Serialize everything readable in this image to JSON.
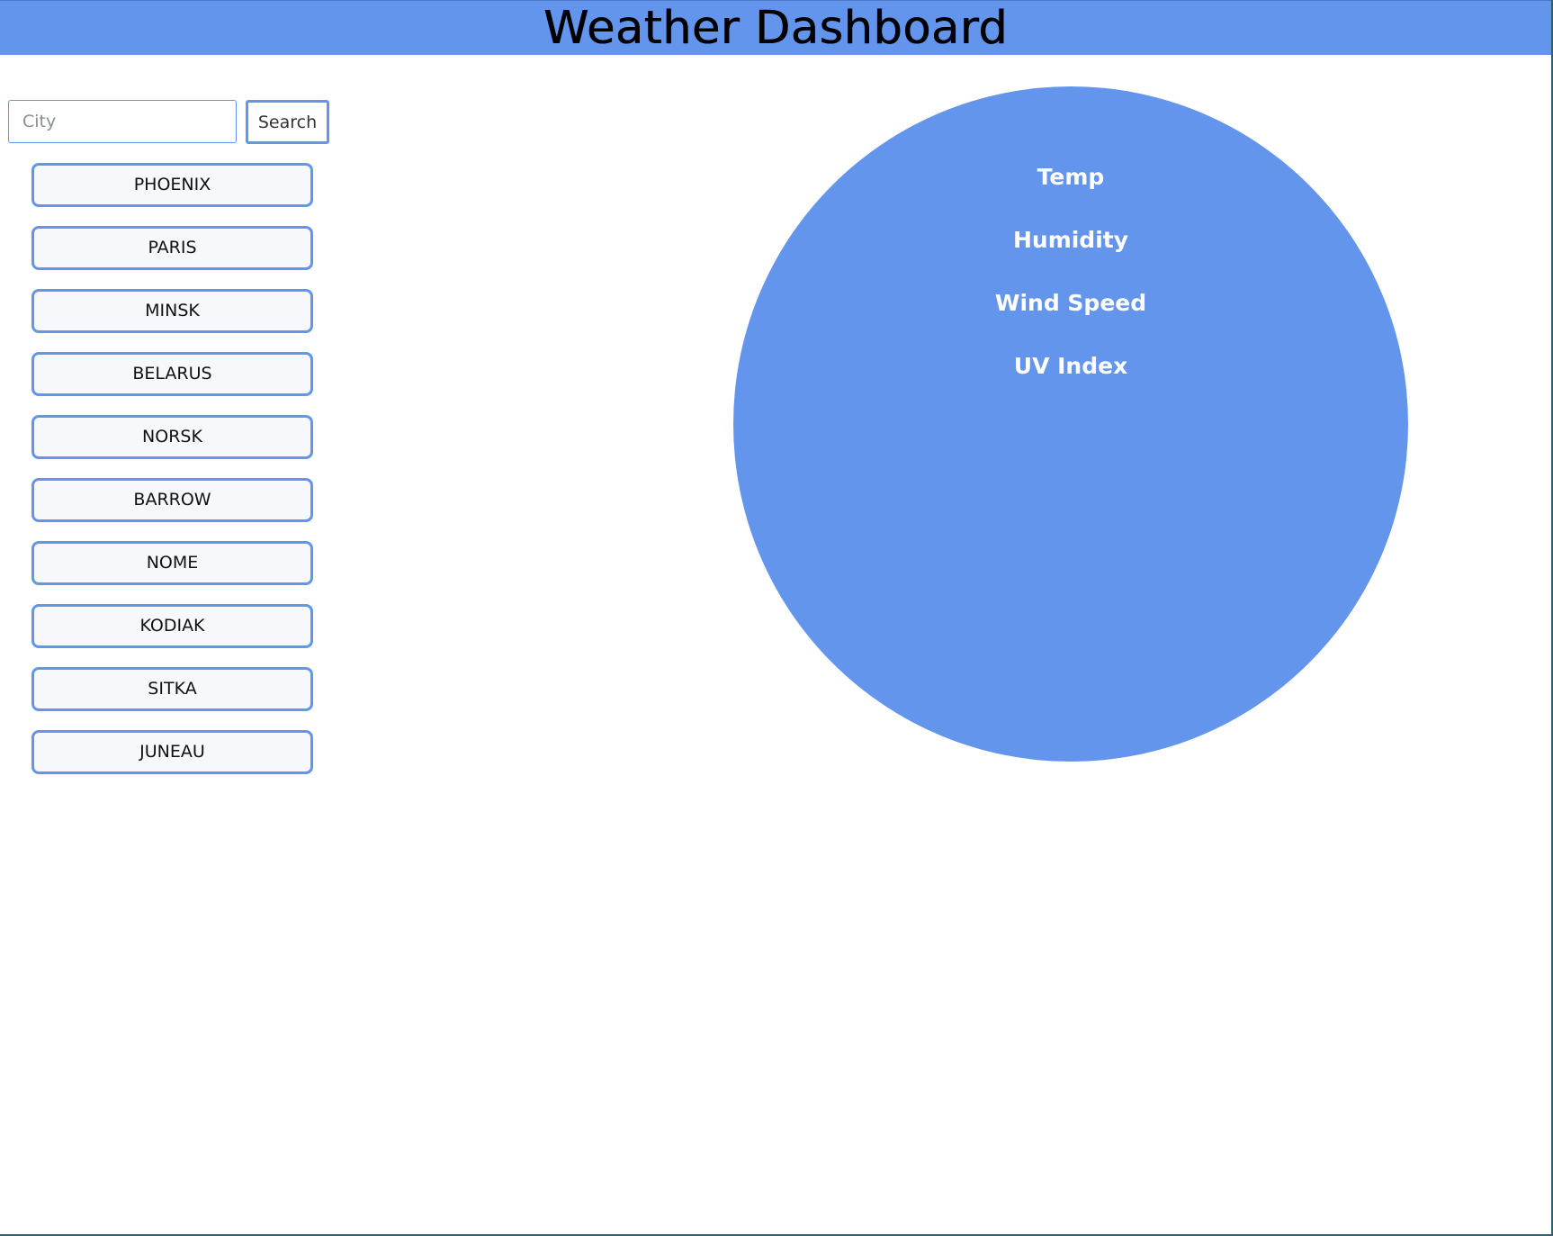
{
  "page": {
    "title": "Weather Dashboard"
  },
  "search": {
    "placeholder": "City",
    "value": "",
    "button_label": "Search"
  },
  "history": {
    "cities": [
      "PHOENIX",
      "PARIS",
      "MINSK",
      "BELARUS",
      "NORSK",
      "BARROW",
      "NOME",
      "KODIAK",
      "SITKA",
      "JUNEAU"
    ]
  },
  "current_weather": {
    "metrics": [
      "Temp",
      "Humidity",
      "Wind Speed",
      "UV Index"
    ]
  },
  "colors": {
    "accent": "#6495ed",
    "page_background": "#ffffff",
    "text_on_accent": "#ffffff",
    "city_button_background": "#f7f8fc"
  }
}
